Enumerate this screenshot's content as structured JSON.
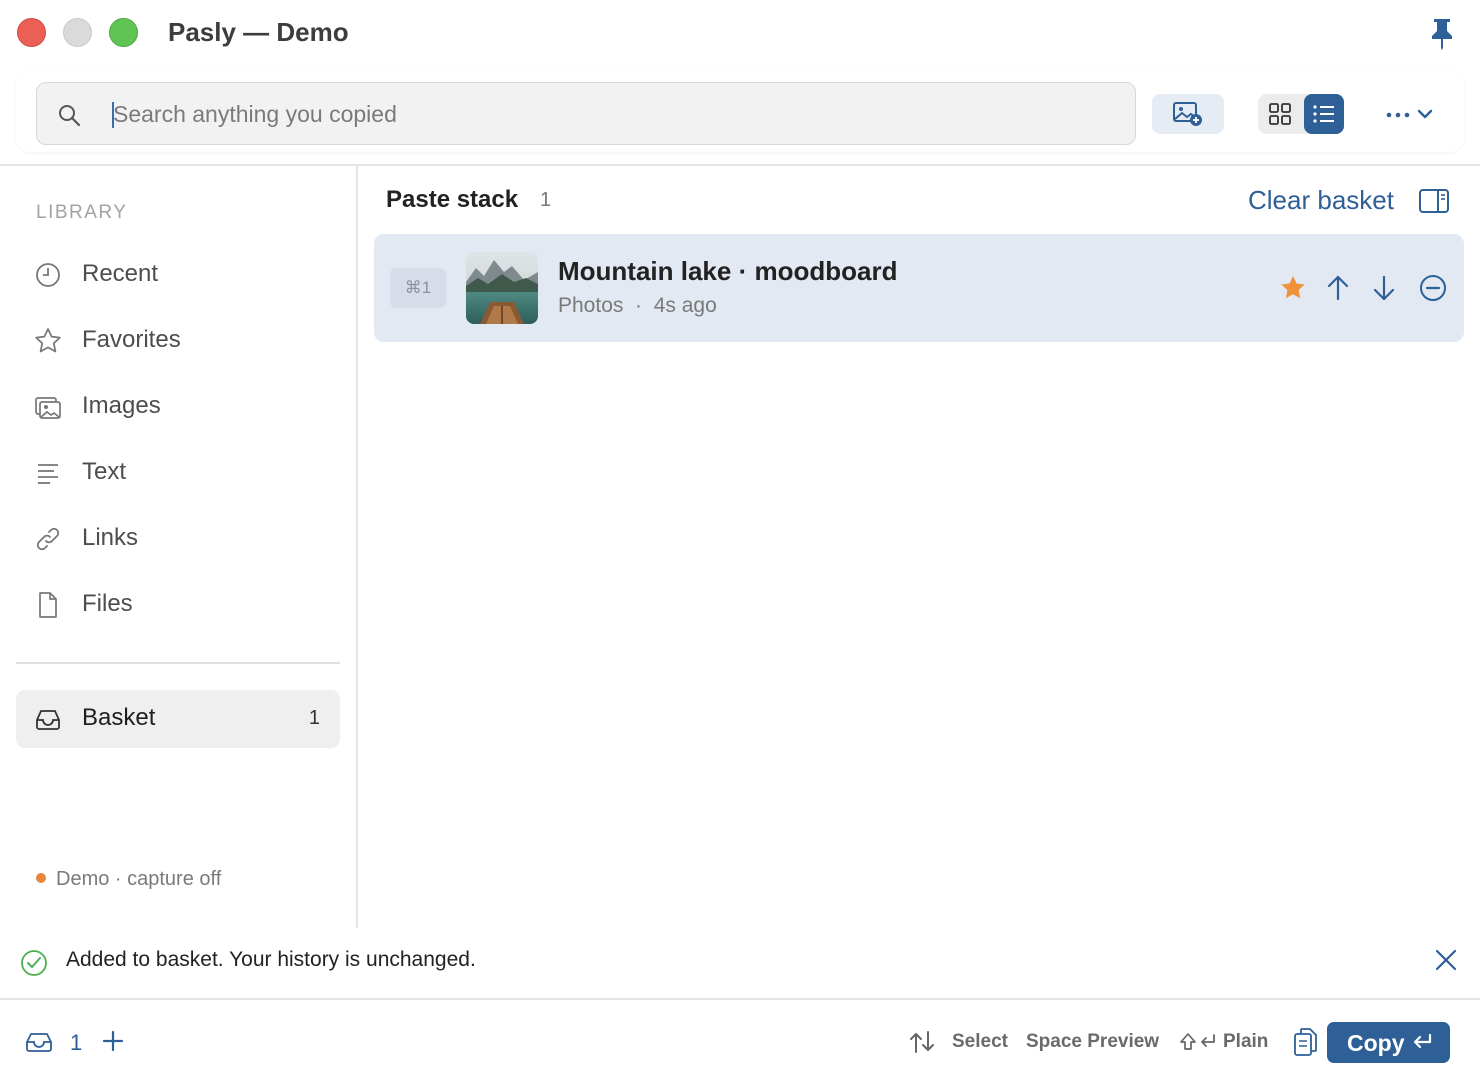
{
  "window": {
    "title": "Pasly — Demo"
  },
  "toolbar": {
    "search_placeholder": "Search anything you copied",
    "search_value": ""
  },
  "sidebar": {
    "section_label": "LIBRARY",
    "items": [
      {
        "label": "Recent",
        "icon": "clock-icon"
      },
      {
        "label": "Favorites",
        "icon": "star-icon"
      },
      {
        "label": "Images",
        "icon": "images-icon"
      },
      {
        "label": "Text",
        "icon": "text-lines-icon"
      },
      {
        "label": "Links",
        "icon": "link-icon"
      },
      {
        "label": "Files",
        "icon": "file-icon"
      }
    ],
    "basket": {
      "label": "Basket",
      "count": "1",
      "icon": "inbox-tray-icon"
    },
    "status": "Demo · capture off"
  },
  "main": {
    "title": "Paste stack",
    "count": "1",
    "clear_label": "Clear basket",
    "items": [
      {
        "shortcut": "⌘1",
        "title": "Mountain lake · moodboard",
        "meta": "Photos  ·  4s ago",
        "favorite": true
      }
    ]
  },
  "toast": {
    "message": "Added to basket. Your history is unchanged."
  },
  "bottom": {
    "basket_count": "1",
    "hint_select": "Select",
    "hint_preview": "Space Preview",
    "hint_plain": "Plain",
    "copy_label": "Copy"
  },
  "colors": {
    "accent": "#2f5f97",
    "favorite": "#f0923a",
    "selected_row": "#e3e9f2",
    "status_dot": "#e8853a",
    "success": "#4caf50"
  }
}
